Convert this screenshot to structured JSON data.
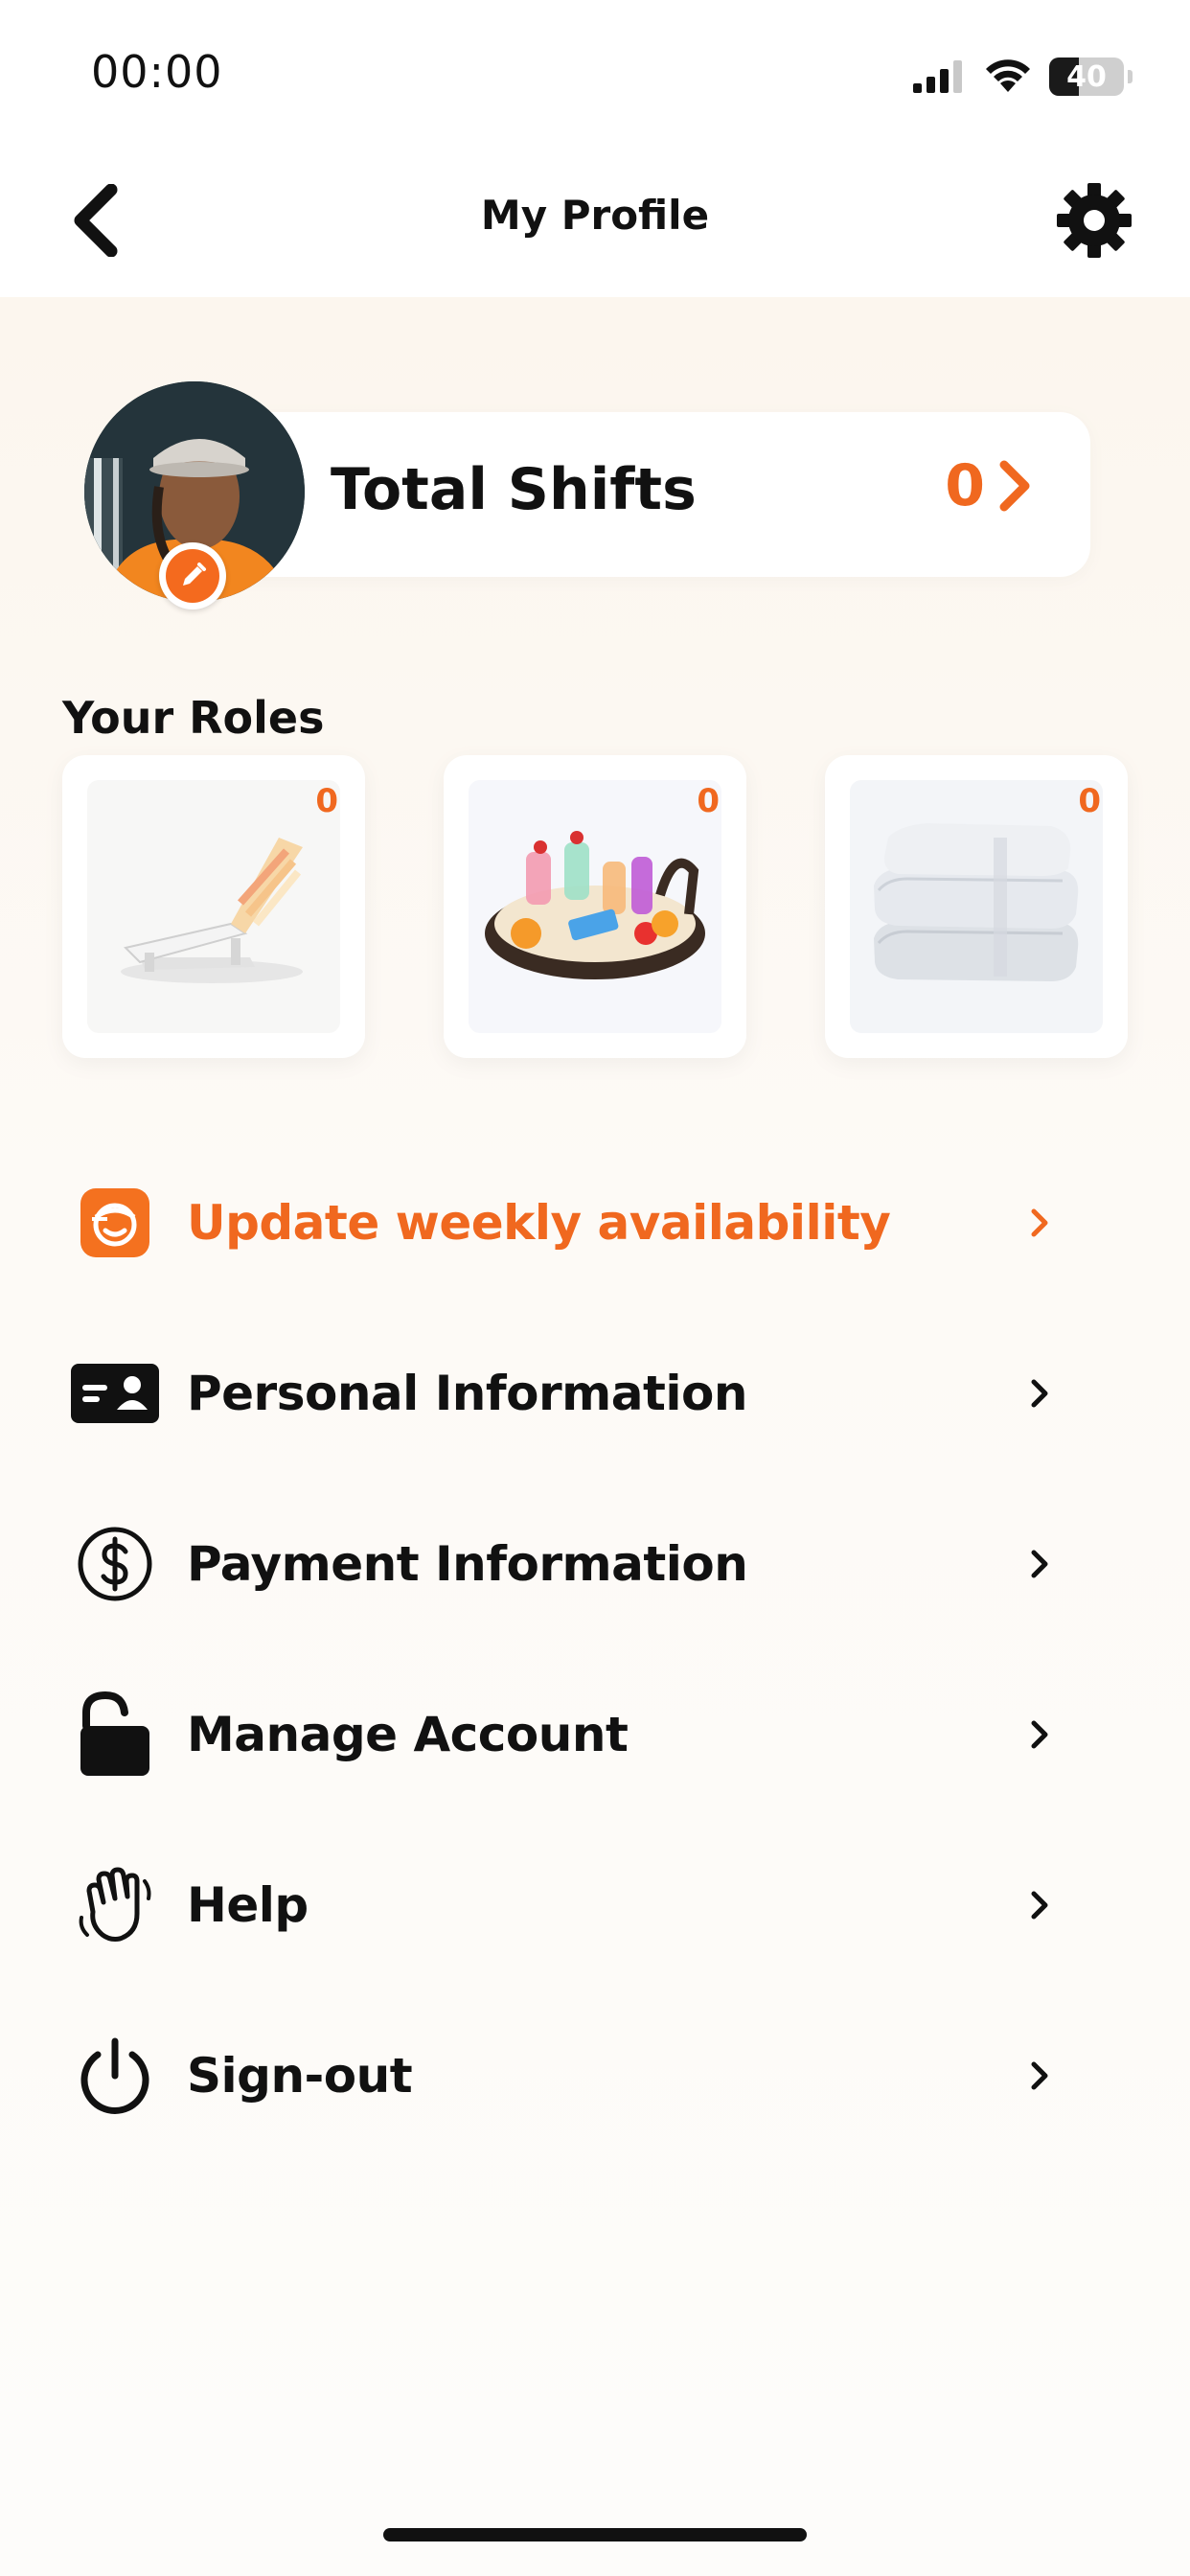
{
  "status_bar": {
    "time": "00:00",
    "battery": "40",
    "battery_level": 0.4
  },
  "nav": {
    "title": "My Profile",
    "back_icon": "chevron-left-icon",
    "settings_icon": "gear-icon"
  },
  "profile": {
    "total_shifts_label": "Total Shifts",
    "total_shifts_count": "0"
  },
  "roles": {
    "title": "Your Roles",
    "items": [
      {
        "name": "lounge-chair",
        "count": "0"
      },
      {
        "name": "drinks-tray",
        "count": "0"
      },
      {
        "name": "towels",
        "count": "0"
      }
    ]
  },
  "menu": {
    "items": [
      {
        "label": "Update weekly availability",
        "icon": "availability-icon",
        "highlight": true
      },
      {
        "label": "Personal Information",
        "icon": "id-card-icon"
      },
      {
        "label": "Payment Information",
        "icon": "dollar-circle-icon"
      },
      {
        "label": "Manage Account",
        "icon": "unlock-icon"
      },
      {
        "label": "Help",
        "icon": "waving-hand-icon"
      },
      {
        "label": "Sign-out",
        "icon": "power-icon"
      }
    ]
  },
  "colors": {
    "accent": "#f0681f",
    "text": "#111111",
    "background": "#fcf7f0"
  }
}
